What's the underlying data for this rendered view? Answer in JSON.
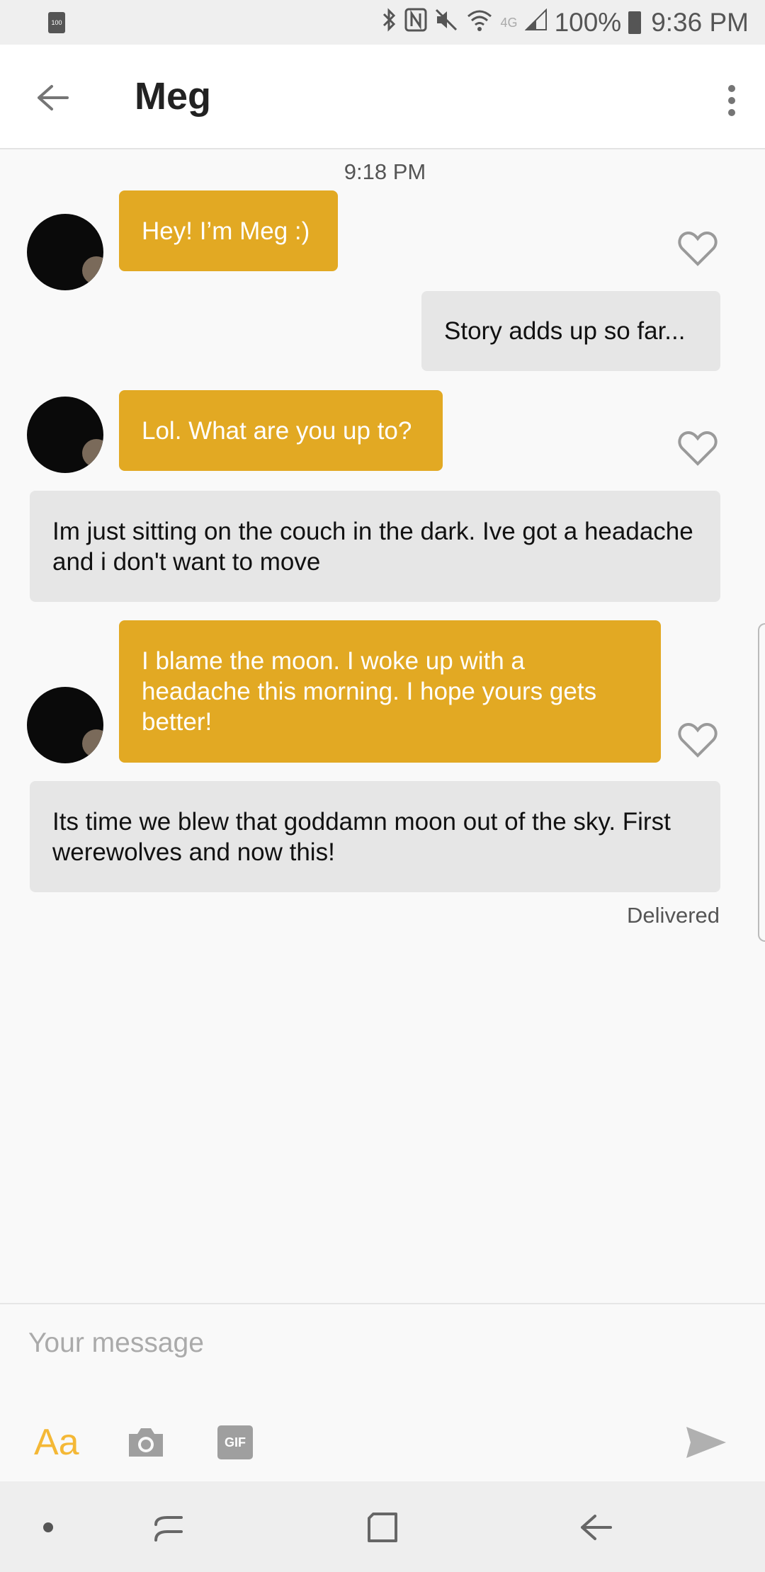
{
  "status_bar": {
    "battery_small": "100",
    "battery_percent": "100%",
    "time": "9:36 PM",
    "network": "4G"
  },
  "header": {
    "title": "Meg"
  },
  "conversation": {
    "timestamp": "9:18 PM",
    "messages": [
      {
        "from": "them",
        "text": "Hey! I’m Meg :)"
      },
      {
        "from": "me",
        "text": "Story adds up so far..."
      },
      {
        "from": "them",
        "text": "Lol. What are you up to?"
      },
      {
        "from": "me",
        "text": "Im just sitting on the couch in the dark. Ive got a headache and i don't want to move"
      },
      {
        "from": "them",
        "text": "I blame the moon. I woke up with a headache this morning. I hope yours gets better!"
      },
      {
        "from": "me",
        "text": "Its time we blew that goddamn moon out of the sky. First werewolves and now this!"
      }
    ],
    "status": "Delivered"
  },
  "composer": {
    "placeholder": "Your message",
    "text_format_label": "Aa",
    "gif_label": "GIF"
  },
  "colors": {
    "accent": "#e2a923",
    "format_label": "#f4b836",
    "sent_bubble": "#e6e6e6"
  }
}
